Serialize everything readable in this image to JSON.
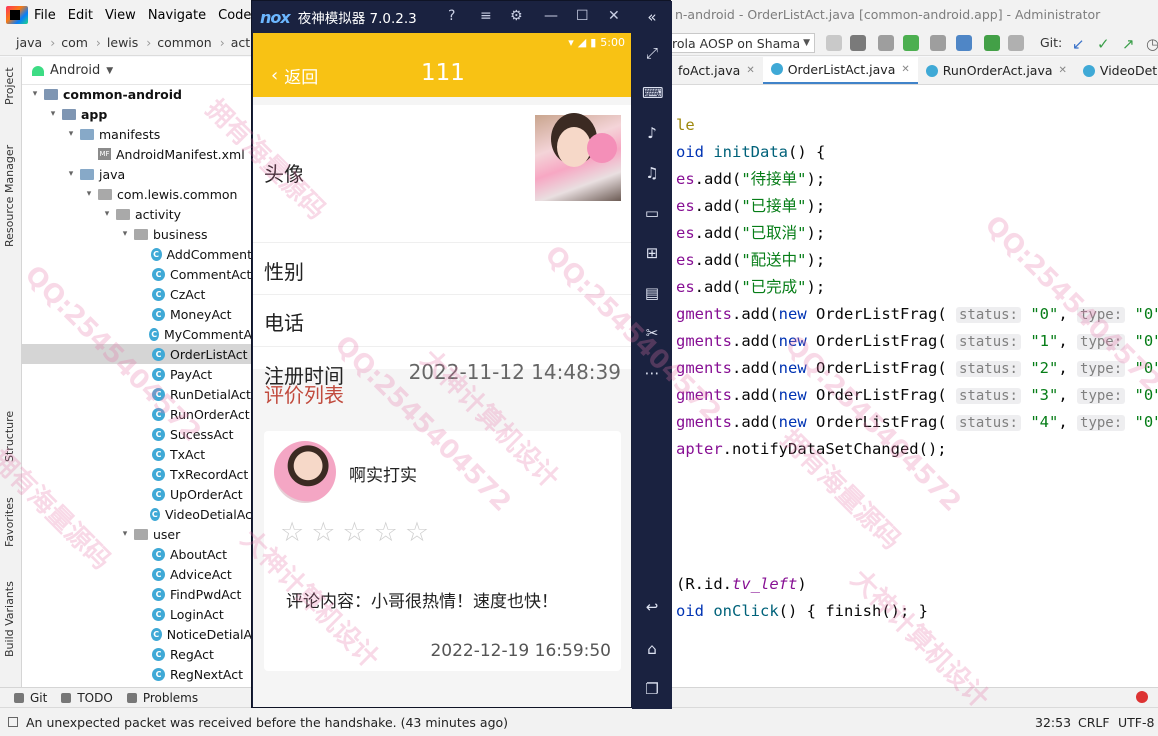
{
  "ide": {
    "title": "n-android - OrderListAct.java [common-android.app] - Administrator",
    "menu": [
      "File",
      "Edit",
      "View",
      "Navigate",
      "Code"
    ],
    "breadcrumbs": [
      "java",
      "com",
      "lewis",
      "common",
      "activity"
    ],
    "run_config": "rola AOSP on Shama",
    "git_label": "Git:",
    "project_view": "Android",
    "stripe_project": "Project",
    "stripe_resource": "Resource Manager",
    "stripe_structure": "Structure",
    "stripe_favorites": "Favorites",
    "stripe_build": "Build Variants"
  },
  "tree": [
    {
      "label": "common-android",
      "kind": "module",
      "indent": 0,
      "arrow": "▾",
      "bold": true
    },
    {
      "label": "app",
      "kind": "module",
      "indent": 1,
      "arrow": "▾",
      "bold": true
    },
    {
      "label": "manifests",
      "kind": "folder",
      "indent": 2,
      "arrow": "▾"
    },
    {
      "label": "AndroidManifest.xml",
      "kind": "manifest",
      "indent": 3,
      "arrow": ""
    },
    {
      "label": "java",
      "kind": "folder",
      "indent": 2,
      "arrow": "▾"
    },
    {
      "label": "com.lewis.common",
      "kind": "package",
      "indent": 3,
      "arrow": "▾"
    },
    {
      "label": "activity",
      "kind": "package",
      "indent": 4,
      "arrow": "▾"
    },
    {
      "label": "business",
      "kind": "package",
      "indent": 5,
      "arrow": "▾"
    },
    {
      "label": "AddComment",
      "kind": "class",
      "indent": 6,
      "arrow": ""
    },
    {
      "label": "CommentAct",
      "kind": "class",
      "indent": 6,
      "arrow": ""
    },
    {
      "label": "CzAct",
      "kind": "class",
      "indent": 6,
      "arrow": ""
    },
    {
      "label": "MoneyAct",
      "kind": "class",
      "indent": 6,
      "arrow": ""
    },
    {
      "label": "MyCommentA",
      "kind": "class",
      "indent": 6,
      "arrow": ""
    },
    {
      "label": "OrderListAct",
      "kind": "class",
      "indent": 6,
      "arrow": "",
      "selected": true
    },
    {
      "label": "PayAct",
      "kind": "class",
      "indent": 6,
      "arrow": ""
    },
    {
      "label": "RunDetialAct",
      "kind": "class",
      "indent": 6,
      "arrow": ""
    },
    {
      "label": "RunOrderAct",
      "kind": "class",
      "indent": 6,
      "arrow": ""
    },
    {
      "label": "SucessAct",
      "kind": "class",
      "indent": 6,
      "arrow": ""
    },
    {
      "label": "TxAct",
      "kind": "class",
      "indent": 6,
      "arrow": ""
    },
    {
      "label": "TxRecordAct",
      "kind": "class",
      "indent": 6,
      "arrow": ""
    },
    {
      "label": "UpOrderAct",
      "kind": "class",
      "indent": 6,
      "arrow": ""
    },
    {
      "label": "VideoDetialAc",
      "kind": "class",
      "indent": 6,
      "arrow": ""
    },
    {
      "label": "user",
      "kind": "package",
      "indent": 5,
      "arrow": "▾"
    },
    {
      "label": "AboutAct",
      "kind": "class",
      "indent": 6,
      "arrow": ""
    },
    {
      "label": "AdviceAct",
      "kind": "class",
      "indent": 6,
      "arrow": ""
    },
    {
      "label": "FindPwdAct",
      "kind": "class",
      "indent": 6,
      "arrow": ""
    },
    {
      "label": "LoginAct",
      "kind": "class",
      "indent": 6,
      "arrow": ""
    },
    {
      "label": "NoticeDetialA",
      "kind": "class",
      "indent": 6,
      "arrow": ""
    },
    {
      "label": "RegAct",
      "kind": "class",
      "indent": 6,
      "arrow": ""
    },
    {
      "label": "RegNextAct",
      "kind": "class",
      "indent": 6,
      "arrow": ""
    }
  ],
  "editor_tabs": [
    {
      "label": "foAct.java",
      "active": false
    },
    {
      "label": "OrderListAct.java",
      "active": true
    },
    {
      "label": "RunOrderAct.java",
      "active": false
    },
    {
      "label": "VideoDetialAct",
      "active": false
    }
  ],
  "bottom_tools": [
    "Git",
    "TODO",
    "Problems"
  ],
  "status": {
    "message": "An unexpected packet was received before the handshake. (43 minutes ago)",
    "position": "32:53",
    "line_sep": "CRLF",
    "encoding": "UTF-8"
  },
  "emulator": {
    "brand": "nox",
    "title": "夜神模拟器 7.0.2.3",
    "clock": "5:00",
    "back_label": "返回",
    "page_title": "111",
    "avatar_label": "头像",
    "gender_label": "性别",
    "phone_label": "电话",
    "reg_label": "注册时间",
    "reg_value": "2022-11-12 14:48:39",
    "reviews_title": "评价列表",
    "comment": {
      "name": "啊实打实",
      "stars": "☆☆☆☆☆",
      "rating": 0,
      "content": "评论内容：小哥很热情！速度也快！",
      "date": "2022-12-19 16:59:50"
    }
  },
  "watermarks": [
    "QQ:2545404572",
    "拥有海量源码",
    "大神计算机设计"
  ]
}
